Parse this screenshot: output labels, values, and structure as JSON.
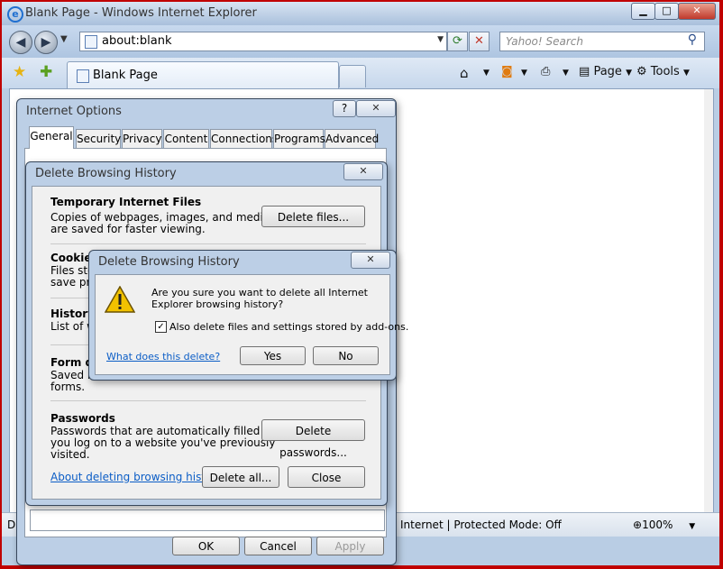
{
  "browser": {
    "title": "Blank Page - Windows Internet Explorer",
    "address": "about:blank",
    "search_placeholder": "Yahoo! Search",
    "tab_label": "Blank Page",
    "toolbar": {
      "page_label": "Page",
      "tools_label": "Tools"
    },
    "status": {
      "left_char": "D",
      "zone_text": "Internet | Protected Mode: Off",
      "zoom": "100%"
    }
  },
  "internet_options": {
    "title": "Internet Options",
    "tabs": [
      "General",
      "Security",
      "Privacy",
      "Content",
      "Connections",
      "Programs",
      "Advanced"
    ],
    "buttons": {
      "ok": "OK",
      "cancel": "Cancel",
      "apply": "Apply"
    }
  },
  "delete_history": {
    "title": "Delete Browsing History",
    "sections": [
      {
        "heading": "Temporary Internet Files",
        "desc1": "Copies of webpages, images, and media that",
        "desc2": "are saved for faster viewing.",
        "button": "Delete files..."
      },
      {
        "heading": "Cookies",
        "desc1": "Files stor",
        "desc2": "save pre"
      },
      {
        "heading": "History",
        "desc1": "List of we"
      },
      {
        "heading": "Form da",
        "desc1": "Saved in",
        "desc2": "forms."
      },
      {
        "heading": "Passwords",
        "desc1": "Passwords that are automatically filled in when",
        "desc2": "you log on to a website you've previously",
        "desc3": "visited.",
        "button": "Delete passwords..."
      }
    ],
    "link": "About deleting browsing history",
    "buttons": {
      "delete_all": "Delete all...",
      "close": "Close"
    }
  },
  "confirm": {
    "title": "Delete Browsing History",
    "message1": "Are you sure you want to delete all Internet",
    "message2": "Explorer browsing history?",
    "checkbox_label": "Also delete files and settings stored by add-ons.",
    "checkbox_checked": true,
    "link": "What does this delete?",
    "buttons": {
      "yes": "Yes",
      "no": "No"
    }
  }
}
